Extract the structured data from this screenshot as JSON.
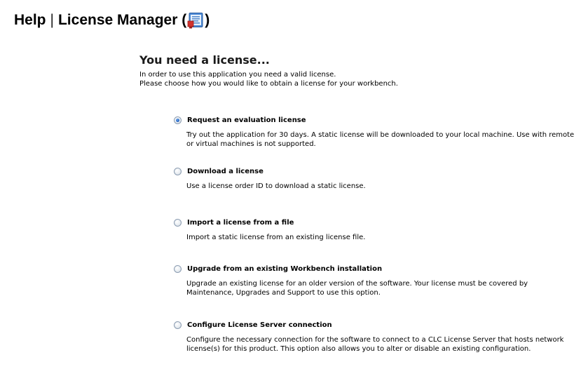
{
  "header": {
    "help": "Help",
    "separator": "|",
    "title_prefix": "License Manager (",
    "title_suffix": ")",
    "icon": "license-manager-icon"
  },
  "panel": {
    "title": "You need a license...",
    "intro_line1": "In order to use this application you need a valid license.",
    "intro_line2": "Please choose how you would like to obtain a license for your workbench."
  },
  "options": [
    {
      "label": "Request an evaluation license",
      "selected": true,
      "description": "Try out the application for 30 days. A static license will be downloaded to your local machine. Use with remote or virtual machines is not supported."
    },
    {
      "label": "Download a license",
      "selected": false,
      "description": "Use a license order ID to download a static license."
    },
    {
      "label": "Import a license from a file",
      "selected": false,
      "description": "Import a static license from an existing license file."
    },
    {
      "label": "Upgrade from an existing Workbench installation",
      "selected": false,
      "description": "Upgrade an existing license for an older version of the software. Your license must be covered by Maintenance, Upgrades and Support to use this option."
    },
    {
      "label": "Configure License Server connection",
      "selected": false,
      "description": "Configure the necessary connection for the software to connect to a CLC License Server that hosts network license(s) for this product. This option also allows you to alter or disable an existing configuration."
    }
  ],
  "colors": {
    "radio_selected": "#1f5fbf",
    "radio_border": "#8a9bb0",
    "icon_blue": "#3a78c8",
    "icon_red": "#d2322d"
  }
}
